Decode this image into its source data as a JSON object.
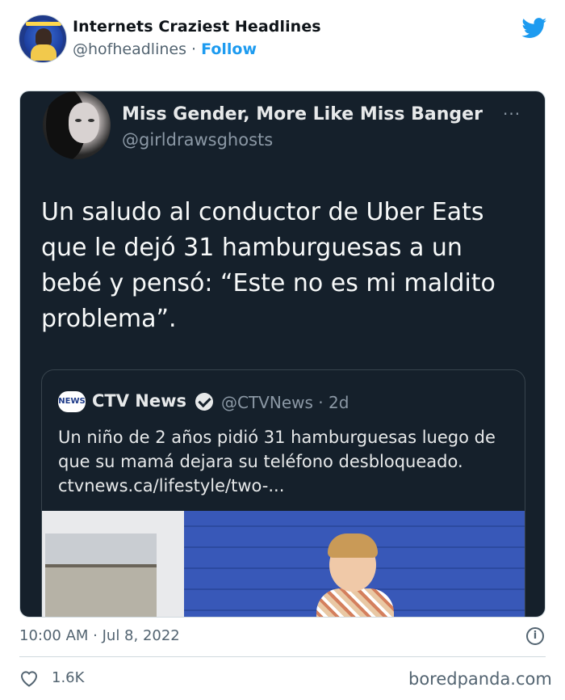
{
  "tweet": {
    "author_name": "Internets Craziest Headlines",
    "handle": "@hofheadlines",
    "separator": "·",
    "follow_label": "Follow",
    "timestamp": "10:00 AM · Jul 8, 2022",
    "likes": "1.6K",
    "info_glyph": "i"
  },
  "embedded": {
    "author_name": "Miss Gender, More Like Miss Banger",
    "handle": "@girldrawsghosts",
    "more_glyph": "···",
    "text": "Un saludo al conductor de Uber Eats que le dejó 31 hamburguesas a un bebé y pensó: “Este no es mi maldito problema”.",
    "quote": {
      "logo_text": "NEWS",
      "author_name": "CTV News",
      "handle_time": "@CTVNews · 2d",
      "text": "Un niño de 2 años pidió 31 hamburguesas luego de que su mamá dejara su teléfono desbloqueado. ctvnews.ca/lifestyle/two-..."
    }
  },
  "watermark": "boredpanda.com",
  "colors": {
    "accent": "#1d9bf0",
    "card_bg": "#15202b",
    "muted": "#536471"
  },
  "icons": [
    "twitter-bird-icon",
    "more-icon",
    "verified-badge-icon",
    "info-icon",
    "heart-icon"
  ]
}
